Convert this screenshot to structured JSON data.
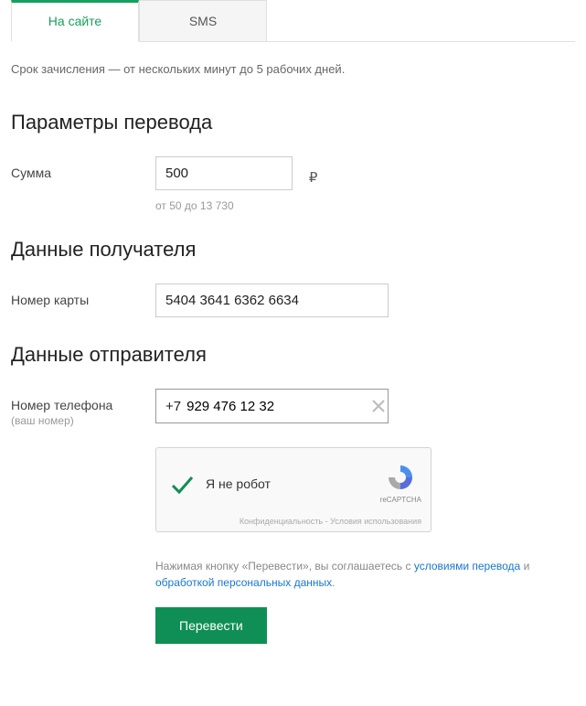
{
  "tabs": {
    "onsite": "На сайте",
    "sms": "SMS"
  },
  "notice": "Срок зачисления — от нескольких минут до 5 рабочих дней.",
  "sections": {
    "params": {
      "heading": "Параметры перевода",
      "amount_label": "Сумма",
      "amount_value": "500",
      "currency": "₽",
      "amount_hint": "от 50 до 13 730"
    },
    "recipient": {
      "heading": "Данные получателя",
      "card_label": "Номер карты",
      "card_value": "5404 3641 6362 6634"
    },
    "sender": {
      "heading": "Данные отправителя",
      "phone_label": "Номер телефона",
      "phone_sublabel": "(ваш номер)",
      "phone_prefix": "+7",
      "phone_value": "929 476 12 32"
    }
  },
  "recaptcha": {
    "text": "Я не робот",
    "brand": "reCAPTCHA",
    "footer": "Конфиденциальность - Условия использования"
  },
  "consent": {
    "prefix": "Нажимая кнопку «Перевести», вы соглашаетесь с ",
    "link1": "условиями перевода",
    "middle": " и ",
    "link2": "обработкой персональных данных",
    "suffix": "."
  },
  "submit": "Перевести"
}
